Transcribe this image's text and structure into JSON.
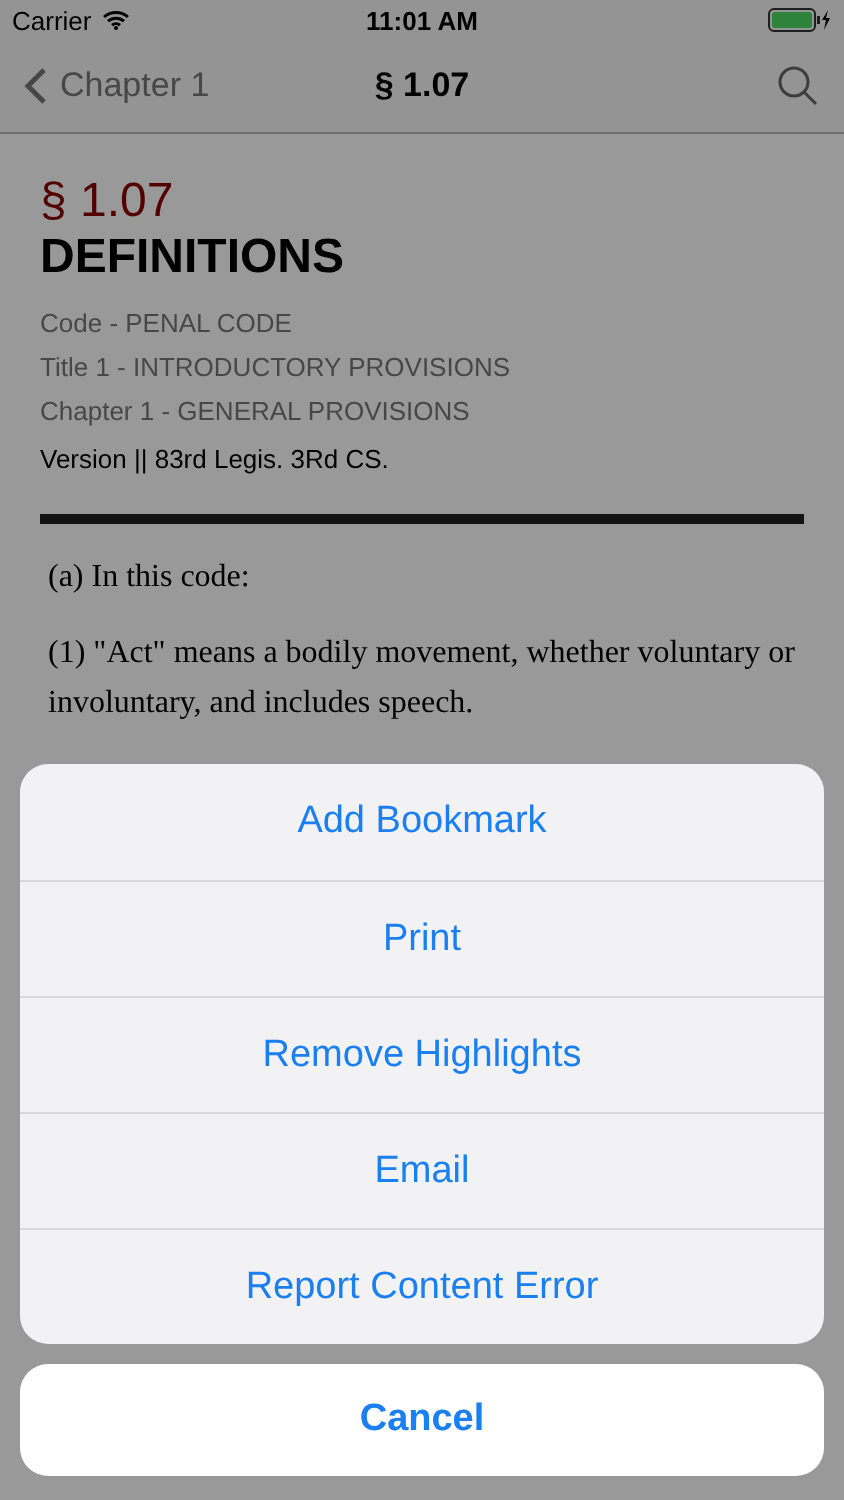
{
  "status_bar": {
    "carrier": "Carrier",
    "time": "11:01 AM"
  },
  "nav": {
    "back": "Chapter 1",
    "title": "§ 1.07"
  },
  "section": {
    "number": "§ 1.07",
    "heading": "DEFINITIONS",
    "meta": [
      "Code - PENAL CODE",
      "Title 1 - INTRODUCTORY PROVISIONS",
      "Chapter 1 - GENERAL PROVISIONS"
    ],
    "version": "Version || 83rd Legis. 3Rd CS."
  },
  "body": [
    "(a) In this code:",
    "(1) \"Act\" means a bodily movement, whether voluntary or involuntary, and includes speech."
  ],
  "action_sheet": {
    "actions": [
      "Add Bookmark",
      "Print",
      "Remove Highlights",
      "Email",
      "Report Content Error"
    ],
    "cancel": "Cancel"
  }
}
